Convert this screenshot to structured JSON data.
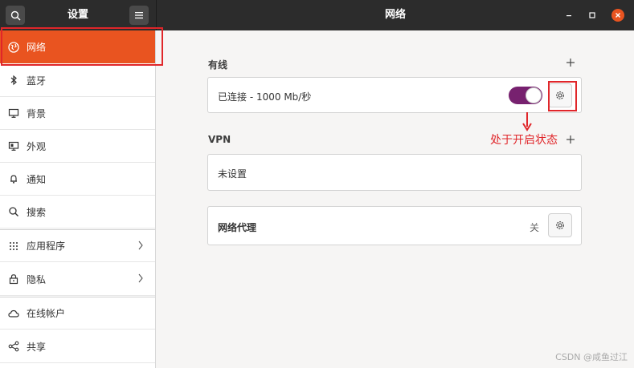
{
  "window": {
    "sidebar_title": "设置",
    "main_title": "网络"
  },
  "sidebar": {
    "items": [
      {
        "label": "网络",
        "icon": "network-globe-icon",
        "active": true
      },
      {
        "label": "蓝牙",
        "icon": "bluetooth-icon"
      },
      {
        "label": "背景",
        "icon": "monitor-icon"
      },
      {
        "label": "外观",
        "icon": "appearance-icon"
      },
      {
        "label": "通知",
        "icon": "bell-icon"
      },
      {
        "label": "搜索",
        "icon": "search-icon"
      },
      {
        "label": "应用程序",
        "icon": "apps-grid-icon",
        "has_submenu": true
      },
      {
        "label": "隐私",
        "icon": "lock-icon",
        "has_submenu": true
      },
      {
        "label": "在线帐户",
        "icon": "cloud-icon"
      },
      {
        "label": "共享",
        "icon": "share-icon"
      }
    ]
  },
  "wired": {
    "section_title": "有线",
    "connection_label": "已连接 - 1000 Mb/秒",
    "toggle_on": true
  },
  "vpn": {
    "section_title": "VPN",
    "empty_label": "未设置"
  },
  "proxy": {
    "label": "网络代理",
    "status": "关"
  },
  "annotation": {
    "text": "处于开启状态"
  },
  "watermark": "CSDN @咸鱼过江",
  "colors": {
    "accent": "#e95420",
    "toggle": "#77216f",
    "annotation": "#e0262a"
  }
}
